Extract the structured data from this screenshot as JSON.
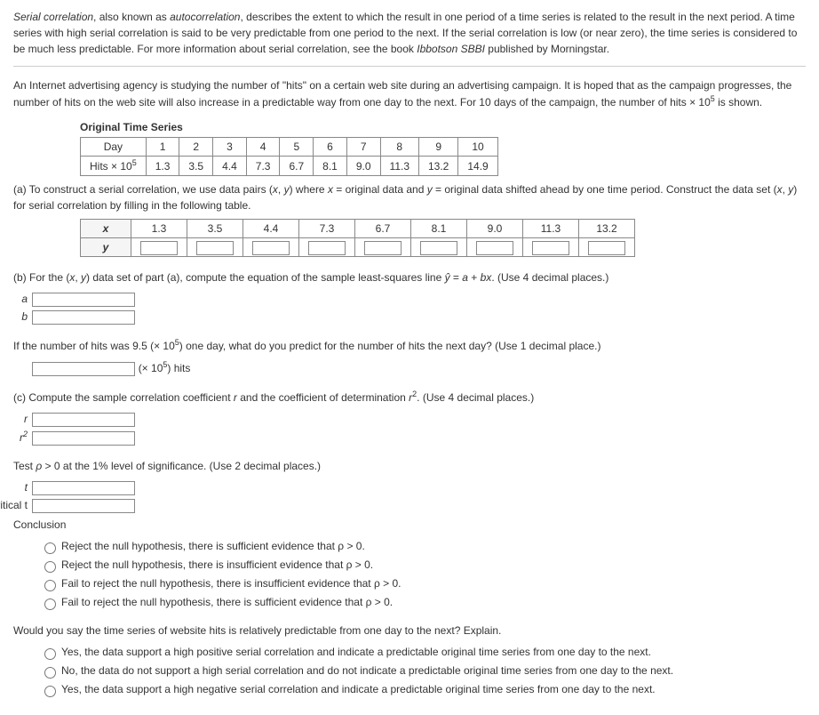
{
  "intro1a": "Serial correlation",
  "intro1b": ", also known as ",
  "intro1c": "autocorrelation",
  "intro1d": ", describes the extent to which the result in one period of a time series is related to the result in the next period. A time series with high serial correlation is said to be very predictable from one period to the next. If the serial correlation is low (or near zero), the time series is considered to be much less predictable. For more information about serial correlation, see the book ",
  "intro1e": "Ibbotson SBBI",
  "intro1f": " published by Morningstar.",
  "intro2a": "An Internet advertising agency is studying the number of \"hits\" on a certain web site during an advertising campaign. It is hoped that as the campaign progresses, the number of hits on the web site will also increase in a predictable way from one day to the next. For 10 days of the campaign, the number of  hits × 10",
  "intro2sup": "5",
  "intro2b": "  is shown.",
  "orig_title": "Original Time Series",
  "row1_label": "Day",
  "row2_label": "Hits × 10",
  "row2_sup": "5",
  "days": [
    "1",
    "2",
    "3",
    "4",
    "5",
    "6",
    "7",
    "8",
    "9",
    "10"
  ],
  "hits": [
    "1.3",
    "3.5",
    "4.4",
    "7.3",
    "6.7",
    "8.1",
    "9.0",
    "11.3",
    "13.2",
    "14.9"
  ],
  "qa1": "(a) To construct a serial correlation, we use data pairs  (",
  "qa_x": "x",
  "qa_comma": ", ",
  "qa_y": "y",
  "qa2": ")  where ",
  "qa3": " = original data and ",
  "qa4": " = original data shifted ahead by one time period. Construct the data set  (",
  "qa5": ")  for serial correlation by filling in the following table.",
  "corr_x_label": "x",
  "corr_y_label": "y",
  "corr_x": [
    "1.3",
    "3.5",
    "4.4",
    "7.3",
    "6.7",
    "8.1",
    "9.0",
    "11.3",
    "13.2"
  ],
  "qb1": "(b) For the  (",
  "qb2": ")  data set of part (a), compute the equation of the sample least-squares line  ",
  "qb_yhat": "ŷ",
  "qb_eq": " = ",
  "qb_a": "a",
  "qb_plus": " + ",
  "qb_b": "b",
  "qb_xvar": "x",
  "qb3": ".  (Use 4 decimal places.)",
  "label_a": "a",
  "label_b": "b",
  "predict1": "If the number of hits was  9.5 (× 10",
  "predict_sup": "5",
  "predict2": ")  one day, what do you predict for the number of hits the next day? (Use 1 decimal place.)",
  "predict_unit1": "(× 10",
  "predict_unit_sup": "5",
  "predict_unit2": ") hits",
  "qc1": "(c) Compute the sample correlation coefficient ",
  "qc_r": "r",
  "qc2": " and the coefficient of determination  ",
  "qc_r2": "r",
  "qc_r2sup": "2",
  "qc3": ".  (Use 4 decimal places.)",
  "label_r": "r",
  "label_r2a": "r",
  "label_r2sup": "2",
  "test1": "Test  ",
  "test_rho": "ρ",
  "test2": " > 0  at the 1% level of significance. (Use 2 decimal places.)",
  "label_t": "t",
  "label_crit": "critical t",
  "conclusion_label": "Conclusion",
  "conc_opts": [
    "Reject the null hypothesis, there is sufficient evidence that ρ > 0.",
    "Reject the null hypothesis, there is insufficient evidence that ρ > 0.",
    "Fail to reject the null hypothesis, there is insufficient evidence that ρ > 0.",
    "Fail to reject the null hypothesis, there is sufficient evidence that ρ > 0."
  ],
  "final_q": "Would you say the time series of website hits is relatively predictable from one day to the next? Explain.",
  "final_opts": [
    "Yes, the data support a high positive serial correlation and indicate a predictable original time series from one day to the next.",
    "No, the data do not support a high serial correlation and do not indicate a predictable original time series from one day to the next.",
    "Yes, the data support a high negative serial correlation and indicate a predictable original time series from one day to the next."
  ]
}
